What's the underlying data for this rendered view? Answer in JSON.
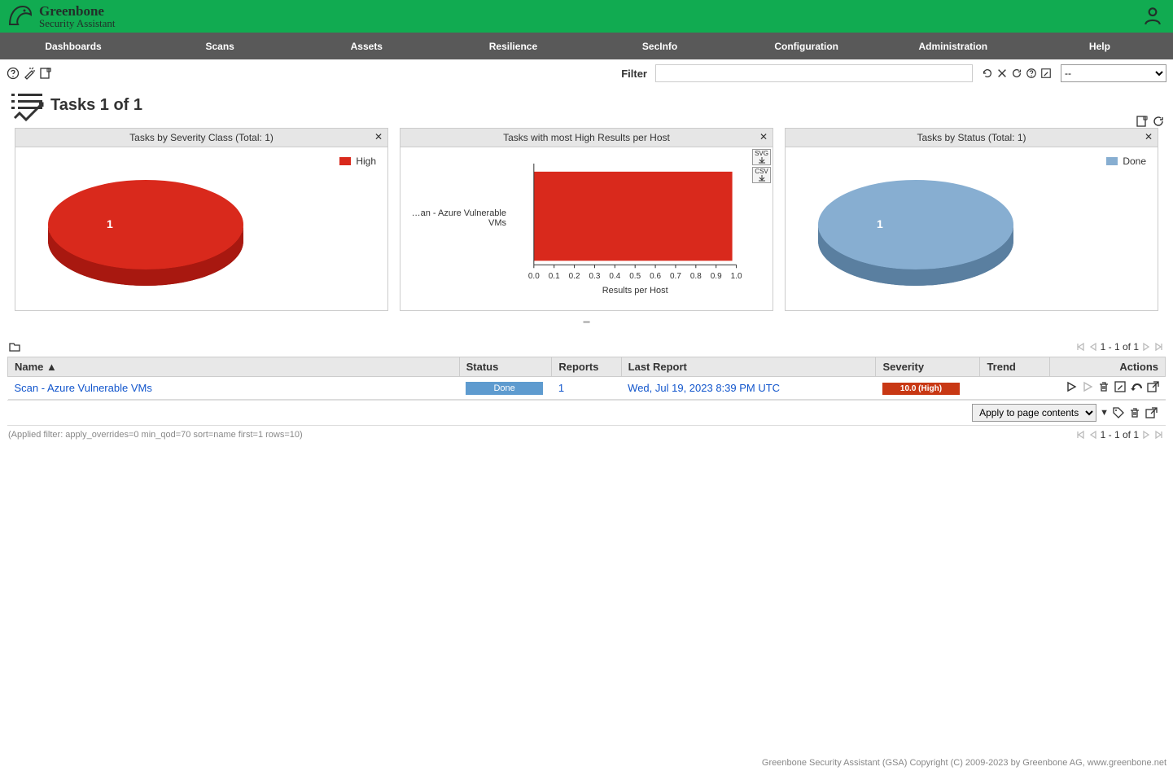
{
  "brand": {
    "main": "Greenbone",
    "sub": "Security Assistant"
  },
  "nav": [
    "Dashboards",
    "Scans",
    "Assets",
    "Resilience",
    "SecInfo",
    "Configuration",
    "Administration",
    "Help"
  ],
  "filter": {
    "label": "Filter",
    "value": "",
    "dropdown": "--"
  },
  "page_title": "Tasks 1 of 1",
  "cards": {
    "severity": {
      "title": "Tasks by Severity Class (Total: 1)",
      "legend": "High",
      "value": "1"
    },
    "highresults": {
      "title": "Tasks with most High Results per Host",
      "category": "…an - Azure Vulnerable VMs",
      "xlabel": "Results per Host",
      "export_svg": "SVG",
      "export_csv": "CSV"
    },
    "status": {
      "title": "Tasks by Status (Total: 1)",
      "legend": "Done",
      "value": "1"
    }
  },
  "chart_data": [
    {
      "type": "pie",
      "title": "Tasks by Severity Class (Total: 1)",
      "series": [
        {
          "name": "High",
          "values": [
            1
          ]
        }
      ],
      "categories": [
        "High"
      ]
    },
    {
      "type": "bar",
      "title": "Tasks with most High Results per Host",
      "categories": [
        "Scan - Azure Vulnerable VMs"
      ],
      "values": [
        1.0
      ],
      "xlabel": "Results per Host",
      "ylabel": "",
      "xlim": [
        0.0,
        1.0
      ],
      "xticks": [
        0.0,
        0.1,
        0.2,
        0.3,
        0.4,
        0.5,
        0.6,
        0.7,
        0.8,
        0.9,
        1.0
      ]
    },
    {
      "type": "pie",
      "title": "Tasks by Status (Total: 1)",
      "series": [
        {
          "name": "Done",
          "values": [
            1
          ]
        }
      ],
      "categories": [
        "Done"
      ]
    }
  ],
  "bar_ticks": [
    "0.0",
    "0.1",
    "0.2",
    "0.3",
    "0.4",
    "0.5",
    "0.6",
    "0.7",
    "0.8",
    "0.9",
    "1.0"
  ],
  "table": {
    "headers": {
      "name": "Name ▲",
      "status": "Status",
      "reports": "Reports",
      "last": "Last Report",
      "severity": "Severity",
      "trend": "Trend",
      "actions": "Actions"
    },
    "rows": [
      {
        "name": "Scan - Azure Vulnerable VMs",
        "status": "Done",
        "reports": "1",
        "last": "Wed, Jul 19, 2023 8:39 PM UTC",
        "severity": "10.0 (High)",
        "trend": ""
      }
    ]
  },
  "pagination": "1 - 1 of 1",
  "apply_select": "Apply to page contents",
  "applied_filter": "(Applied filter: apply_overrides=0 min_qod=70 sort=name first=1 rows=10)",
  "footer": "Greenbone Security Assistant (GSA) Copyright (C) 2009-2023 by Greenbone AG, www.greenbone.net",
  "colors": {
    "high": "#d9291c",
    "high_dark": "#a81810",
    "done": "#87aed1",
    "done_dark": "#5a7fa0"
  }
}
